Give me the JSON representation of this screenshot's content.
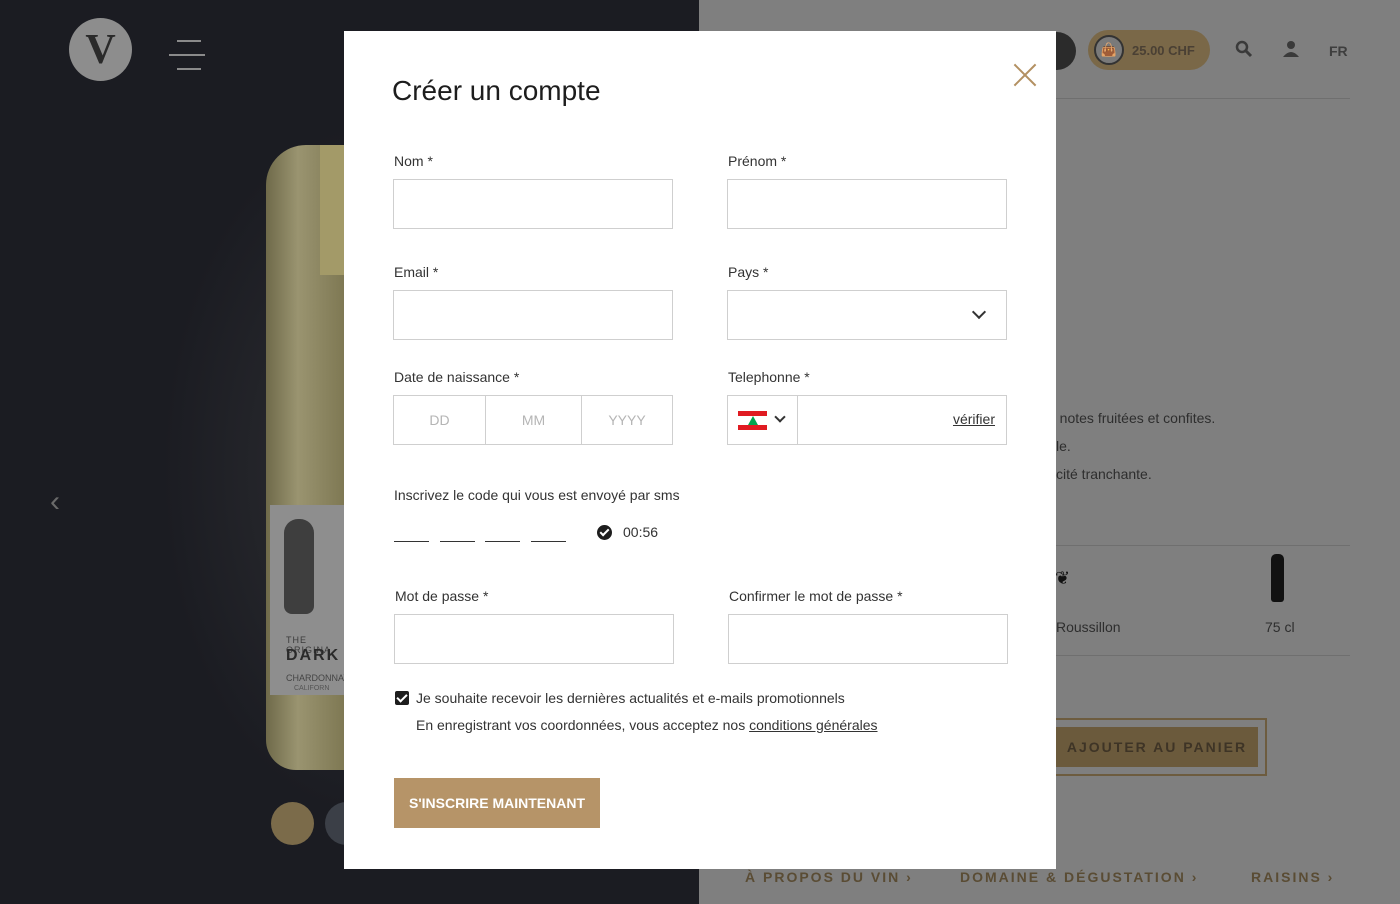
{
  "header": {
    "logo_letter": "V",
    "cart_amount": "25.00 CHF",
    "language": "FR"
  },
  "background": {
    "bottle_label_line1": "THE ORIGINA",
    "bottle_label_line2": "DARK",
    "bottle_label_line3": "CHARDONNAY",
    "bottle_label_line4": "CALIFORN",
    "desc_line1": "e notes fruitées et confites.",
    "desc_line2": "le.",
    "desc_line3": "cité tranchante.",
    "region": "Roussillon",
    "volume": "75 cl",
    "add_to_cart": "AJOUTER AU PANIER",
    "tabs": [
      {
        "label": "À PROPOS DU VIN ›"
      },
      {
        "label": "DOMAINE & DÉGUSTATION ›"
      },
      {
        "label": "RAISINS ›"
      }
    ]
  },
  "modal": {
    "title": "Créer un compte",
    "fields": {
      "nom": {
        "label": "Nom *",
        "value": ""
      },
      "prenom": {
        "label": "Prénom *",
        "value": ""
      },
      "email": {
        "label": "Email *",
        "value": ""
      },
      "pays": {
        "label": "Pays *",
        "value": ""
      },
      "dob": {
        "label": "Date de naissance *",
        "day_placeholder": "DD",
        "month_placeholder": "MM",
        "year_placeholder": "YYYY"
      },
      "telephone": {
        "label": "Telephonne *",
        "value": "",
        "verify_label": "vérifier"
      },
      "password": {
        "label": "Mot de passe *",
        "value": ""
      },
      "confirm_password": {
        "label": "Confirmer le mot de passe *",
        "value": ""
      }
    },
    "sms": {
      "label": "Inscrivez le code qui vous est envoyé par sms",
      "timer": "00:56"
    },
    "newsletter_label": "Je souhaite recevoir les dernières actualités et e-mails promotionnels",
    "newsletter_checked": true,
    "terms_prefix": "En enregistrant vos coordonnées, vous acceptez nos ",
    "terms_link": "conditions générales",
    "submit_label": "S'INSCRIRE MAINTENANT"
  },
  "colors": {
    "accent": "#b69468",
    "close_icon": "#b39062",
    "overlay_dark": "#1b1c22"
  }
}
